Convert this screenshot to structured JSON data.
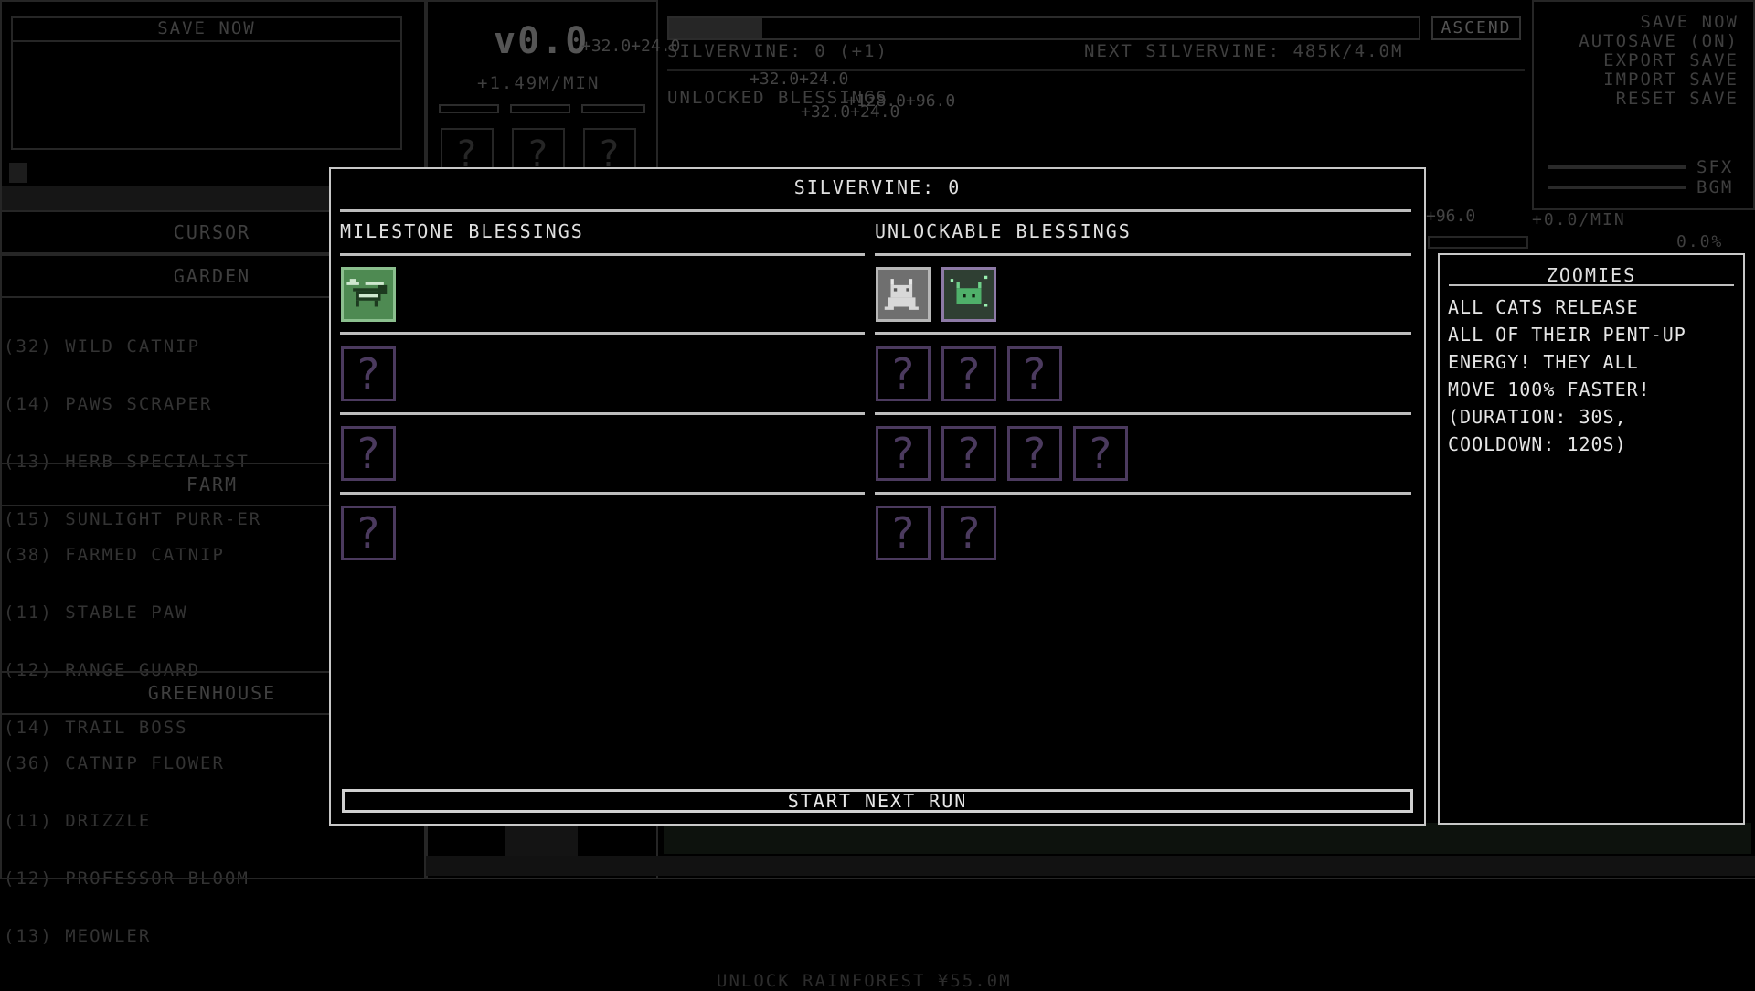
{
  "background": {
    "save_now_label": "SAVE NOW",
    "version": "v0.0",
    "rate_per_min": "+1.49M/MIN",
    "silvervine_header": "SILVERVINE: 0 (+1)",
    "next_silvervine": "NEXT SILVERVINE: 485K/4.0M",
    "ascend_button": "ASCEND",
    "unlocked_blessings": "UNLOCKED BLESSINGS",
    "menu": {
      "save_now": "SAVE NOW",
      "autosave": "AUTOSAVE (ON)",
      "export_save": "EXPORT SAVE",
      "import_save": "IMPORT SAVE",
      "reset_save": "RESET SAVE"
    },
    "audio": {
      "sfx": "SFX",
      "bgm": "BGM"
    },
    "sections": {
      "cursor": "CURSOR",
      "garden": {
        "title": "GARDEN",
        "items": [
          "(32) WILD CATNIP",
          "(14) PAWS SCRAPER",
          "(13) HERB SPECIALIST",
          "(15) SUNLIGHT PURR-ER"
        ]
      },
      "farm": {
        "title": "FARM",
        "items": [
          "(38) FARMED CATNIP",
          "(11) STABLE PAW",
          "(12) RANGE GUARD",
          "(14) TRAIL BOSS"
        ]
      },
      "greenhouse": {
        "title": "GREENHOUSE",
        "items": [
          "(36) CATNIP FLOWER",
          "(11) DRIZZLE",
          "(12) PROFESSOR BLOOM",
          "(13) MEOWLER"
        ]
      }
    },
    "right_stats": {
      "per_min": "+0.0/MIN",
      "percent": "0.0%"
    },
    "floating_numbers": [
      "+32.0+24.0",
      "+32.0+24.0",
      "+128.0+96.0",
      "+32.0+24.0",
      "+96.0"
    ],
    "unlock_hint": "UNLOCK RAINFOREST ¥55.0M"
  },
  "modal": {
    "title": "SILVERVINE: 0",
    "milestone_header": "MILESTONE BLESSINGS",
    "unlockable_header": "UNLOCKABLE BLESSINGS",
    "start_button": "START NEXT RUN",
    "unknown_glyph": "?"
  },
  "tooltip": {
    "title": "ZOOMIES",
    "lines": [
      "ALL CATS RELEASE",
      "ALL OF THEIR PENT-UP",
      "ENERGY! THEY ALL",
      "MOVE 100% FASTER!",
      "(DURATION: 30S,",
      "COOLDOWN: 120S)"
    ]
  },
  "colors": {
    "owned_green": "#4e8a52",
    "locked_purple": "#4b3a5e",
    "border_light": "#c8c8c8"
  }
}
